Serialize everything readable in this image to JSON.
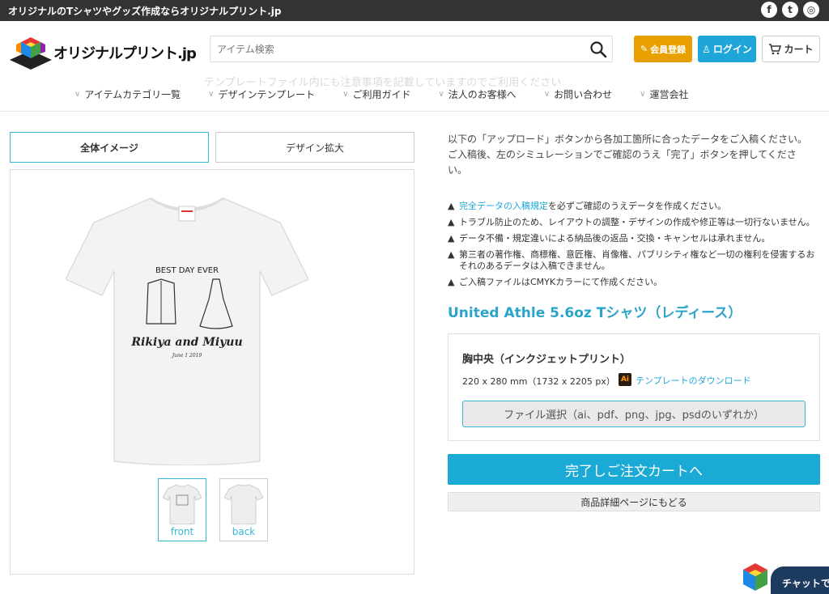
{
  "topbar": {
    "tagline": "オリジナルのTシャツやグッズ作成ならオリジナルプリント.jp",
    "social": [
      "f",
      "t",
      "◎"
    ]
  },
  "header": {
    "logo_text": "オリジナルプリント.jp",
    "search_placeholder": "アイテム検索",
    "ghost_text": "テンプレートファイル内にも注意事項を記載していますのでご利用ください",
    "register_label": "会員登録",
    "login_label": "ログイン",
    "cart_label": "カート"
  },
  "nav": [
    {
      "label": "アイテムカテゴリ一覧"
    },
    {
      "label": "デザインテンプレート"
    },
    {
      "label": "ご利用ガイド"
    },
    {
      "label": "法人のお客様へ"
    },
    {
      "label": "お問い合わせ"
    },
    {
      "label": "運営会社"
    }
  ],
  "tabs": {
    "full_image": "全体イメージ",
    "design_zoom": "デザイン拡大"
  },
  "preview": {
    "design_heading": "BEST DAY EVER",
    "design_names": "Rikiya and Miyuu",
    "design_date": "June 1 2019",
    "thumb_front": "front",
    "thumb_back": "back"
  },
  "instructions": {
    "line1": "以下の「アップロード」ボタンから各加工箇所に合ったデータをご入稿ください。",
    "line2": "ご入稿後、左のシミュレーションでご確認のうえ「完了」ボタンを押してください。"
  },
  "notes": {
    "n1_link": "完全データの入稿規定",
    "n1_rest": "を必ずご確認のうえデータを作成ください。",
    "n2": "トラブル防止のため、レイアウトの調整・デザインの作成や修正等は一切行ないません。",
    "n3": "データ不備・規定違いによる納品後の返品・交換・キャンセルは承れません。",
    "n4": "第三者の著作権、商標権、意匠権、肖像権、パブリシティ権など一切の権利を侵害するおそれのあるデータは入稿できません。",
    "n5": "ご入稿ファイルはCMYKカラーにて作成ください。"
  },
  "product": {
    "title": "United Athle 5.6oz Tシャツ（レディース）",
    "print_position": "胸中央（インクジェットプリント）",
    "size": "220 x 280 mm（1732 x 2205 px）",
    "ai_badge": "Ai",
    "template_link": "テンプレートのダウンロード",
    "file_select": "ファイル選択（ai、pdf、png、jpg、psdのいずれか）"
  },
  "actions": {
    "complete": "完了しご注文カートへ",
    "back": "商品詳細ページにもどる"
  },
  "chat": {
    "label": "チャットで"
  },
  "colors": {
    "accent": "#1ba9d5",
    "register": "#e8a000",
    "topbar": "#333333"
  }
}
